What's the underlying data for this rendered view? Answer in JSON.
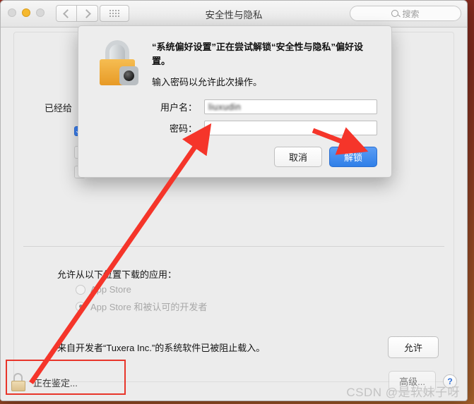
{
  "window": {
    "title": "安全性与隐私",
    "traffic_lights": [
      "close",
      "minimize",
      "zoom"
    ],
    "nav": {
      "back": "back-chevron",
      "forward": "forward-chevron",
      "show_all": "grid-icon"
    },
    "search": {
      "placeholder": "搜索",
      "value": "",
      "icon": "search-icon"
    }
  },
  "content": {
    "behind_text": "已经给",
    "separator": true,
    "section_title": "允许从以下位置下载的应用：",
    "radio_options": [
      {
        "label": "App Store",
        "selected": false
      },
      {
        "label": "App Store 和被认可的开发者",
        "selected": true
      }
    ],
    "developer_notice": {
      "text": "来自开发者“Tuxera Inc.”的系统软件已被阻止载入。",
      "button_label": "允许"
    }
  },
  "bottom_bar": {
    "lock_icon": "lock-open-icon",
    "lock_status": "正在鉴定...",
    "advanced_label": "高级...",
    "help_label": "?",
    "watermark": "CSDN @是软妹子呀"
  },
  "dialog": {
    "icon": "lock-gear-icon",
    "message_bold": "“系统偏好设置”正在尝试解锁“安全性与隐私”偏好设置。",
    "message_sub": "输入密码以允许此次操作。",
    "fields": [
      {
        "label": "用户名：",
        "value": "liuxudin",
        "type": "text",
        "redacted": true
      },
      {
        "label": "密码：",
        "value": "",
        "type": "password",
        "redacted": false
      }
    ],
    "cancel_label": "取消",
    "unlock_label": "解锁"
  },
  "annotations": {
    "arrow_color": "#f5352a",
    "highlight_color": "#e8352a",
    "arrows": [
      {
        "name": "arrow-to-password-field",
        "from": "bottom-left lock",
        "to": "password field"
      },
      {
        "name": "arrow-to-unlock-button",
        "from": "upper right",
        "to": "unlock button"
      }
    ],
    "highlight_box": {
      "name": "lock-status-highlight",
      "target": "正在鉴定..."
    }
  }
}
